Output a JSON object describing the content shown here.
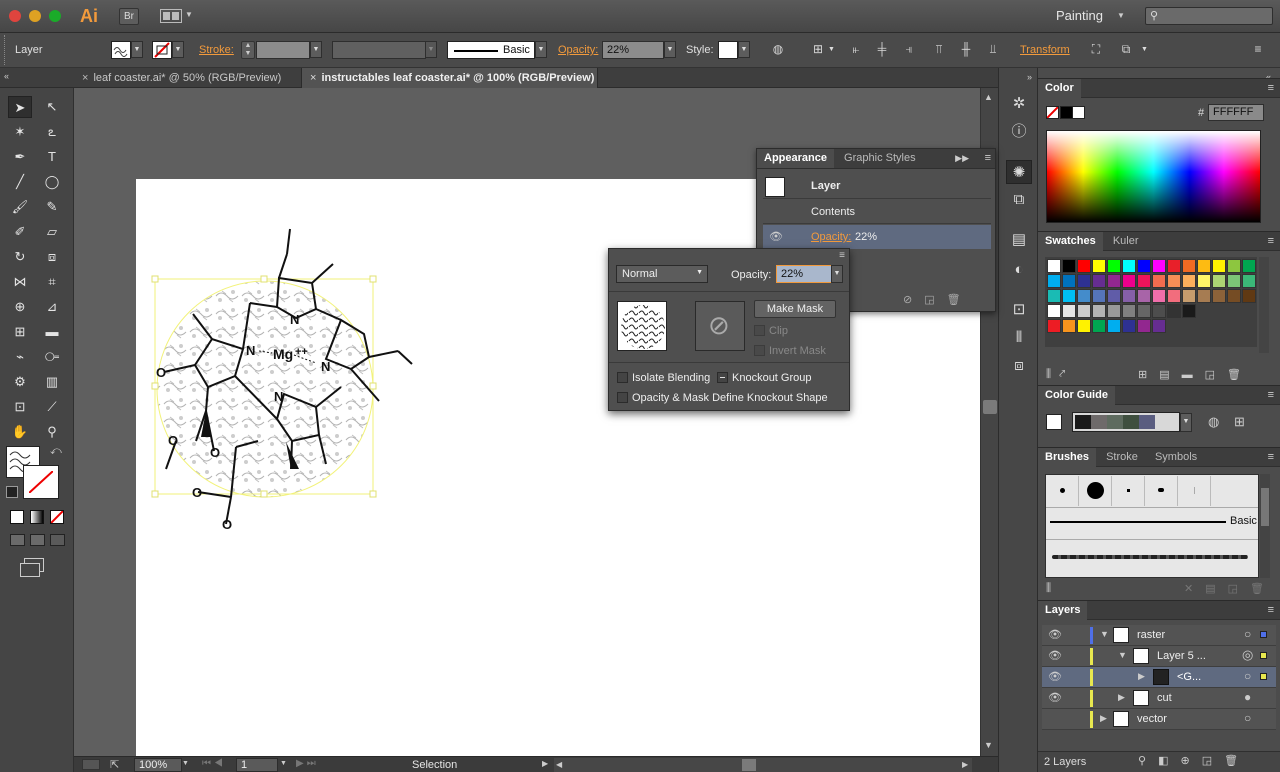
{
  "app": {
    "logo": "Ai",
    "bridge": "Br",
    "workspace": "Painting",
    "search_placeholder": ""
  },
  "control": {
    "selection_label": "Layer",
    "stroke_label": "Stroke:",
    "brush_label": "Basic",
    "opacity_label": "Opacity:",
    "opacity_value": "22%",
    "style_label": "Style:",
    "transform_label": "Transform"
  },
  "tabs": [
    {
      "label": "leaf coaster.ai* @ 50% (RGB/Preview)",
      "active": false
    },
    {
      "label": "instructables leaf coaster.ai* @ 100% (RGB/Preview)",
      "active": true
    }
  ],
  "molecule": {
    "mg_label": "Mg",
    "charge": "++",
    "n_labels": [
      "N",
      "N",
      "N",
      "N"
    ],
    "o_labels": [
      "O",
      "O",
      "O",
      "O",
      "O"
    ]
  },
  "status": {
    "zoom": "100%",
    "page": "1",
    "tool": "Selection"
  },
  "appearance": {
    "tabs": [
      "Appearance",
      "Graphic Styles"
    ],
    "item": "Layer",
    "contents": "Contents",
    "opacity_label": "Opacity:",
    "opacity_value": "22%"
  },
  "transparency": {
    "blend_mode": "Normal",
    "opacity_label": "Opacity:",
    "opacity_value": "22%",
    "make_mask": "Make Mask",
    "clip": "Clip",
    "invert_mask": "Invert Mask",
    "isolate_blending": "Isolate Blending",
    "knockout_group": "Knockout Group",
    "opacity_mask_define": "Opacity & Mask Define Knockout Shape"
  },
  "color_panel": {
    "title": "Color",
    "hash": "#",
    "hex": "FFFFFF"
  },
  "swatches_panel": {
    "tabs": [
      "Swatches",
      "Kuler"
    ]
  },
  "color_guide": {
    "title": "Color Guide"
  },
  "brushes_panel": {
    "tabs": [
      "Brushes",
      "Stroke",
      "Symbols"
    ],
    "basic_label": "Basic"
  },
  "layers_panel": {
    "title": "Layers",
    "rows": [
      "raster",
      "Layer 5 ...",
      "<G...",
      "cut",
      "vector"
    ],
    "footer": "2 Layers"
  },
  "colors": {
    "accent_orange": "#f29a3c",
    "selection_yellow": "#ffff66",
    "panel_bg": "#4c4c4c"
  },
  "swatch_rows": [
    [
      "#ffffff",
      "#000000",
      "#ff0000",
      "#ffff00",
      "#00ff00",
      "#00ffff",
      "#0000ff",
      "#ff00ff",
      "#e8202a",
      "#f06a23",
      "#fdbb12",
      "#fff200",
      "#8dc63f",
      "#00a650"
    ],
    [
      "#00aeef",
      "#0072bc",
      "#2e3192",
      "#662d91",
      "#92278f",
      "#ec008c",
      "#ed145b",
      "#f26c4f",
      "#f68e56",
      "#fbaf5c",
      "#fff568",
      "#acd373",
      "#7cc576",
      "#3bb878"
    ],
    [
      "#1abbb4",
      "#00bff3",
      "#448ccb",
      "#5574b9",
      "#605ca8",
      "#855fa8",
      "#a864a8",
      "#f06eaa",
      "#f26d7d",
      "#c69c6d",
      "#a67c52",
      "#8c6239",
      "#754c24",
      "#603913"
    ],
    [
      "#ffffff",
      "#e6e6e6",
      "#cccccc",
      "#b3b3b3",
      "#999999",
      "#808080",
      "#666666",
      "#4d4d4d",
      "#333333",
      "#1a1a1a"
    ],
    [
      "#ed1c24",
      "#f7941d",
      "#fff200",
      "#00a651",
      "#00aeef",
      "#2e3192",
      "#92278f",
      "#662d91"
    ]
  ]
}
